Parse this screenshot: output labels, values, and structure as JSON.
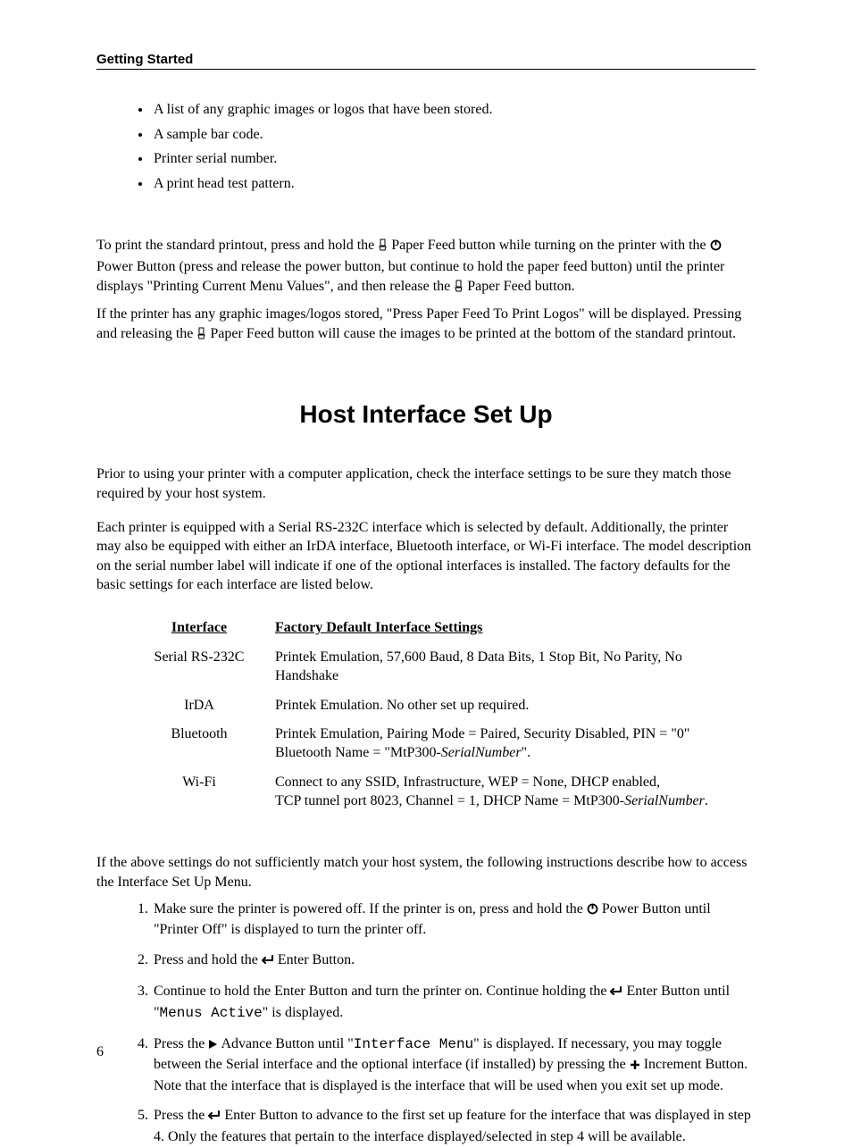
{
  "header": {
    "section": "Getting Started"
  },
  "bullets": [
    "A list of any graphic images or logos that have been stored.",
    "A sample bar code.",
    "Printer serial number.",
    "A print head test pattern."
  ],
  "para1": {
    "a": "To print the standard printout, press and hold the ",
    "b": " Paper Feed button while turning on the printer with the ",
    "c": " Power Button (press and release the power button, but continue to hold the paper feed button) until the printer displays \"Printing Current Menu Values\", and then release the ",
    "d": " Paper Feed button."
  },
  "para2": {
    "a": "If the printer has any graphic images/logos stored, \"Press Paper Feed To Print Logos\" will be displayed.  Pressing and releasing the ",
    "b": " Paper Feed button will cause the images to be printed at the bottom of the standard printout."
  },
  "heading": "Host Interface Set Up",
  "intro1": "Prior to using your printer with a computer application, check the interface settings to be sure they match those required by your host system.",
  "intro2": "Each printer is equipped with a Serial RS-232C interface which is selected by default.  Additionally, the printer may also be equipped with either an IrDA interface, Bluetooth interface, or Wi-Fi interface.  The model description on the serial number label will indicate if one of the optional interfaces is installed.  The factory defaults for the basic settings for each interface are listed below.",
  "table": {
    "headers": {
      "interface": "Interface",
      "defaults": "Factory Default Interface Settings"
    },
    "rows": [
      {
        "interface": "Serial RS-232C",
        "settings_a": "Printek Emulation, 57,600 Baud, 8 Data Bits, 1 Stop Bit, No Parity, No Handshake",
        "settings_b": "",
        "italic_a": "",
        "settings_c": "",
        "italic_b": ""
      },
      {
        "interface": "IrDA",
        "settings_a": "Printek Emulation.  No other set up required.",
        "settings_b": "",
        "italic_a": "",
        "settings_c": "",
        "italic_b": ""
      },
      {
        "interface": "Bluetooth",
        "settings_a": "Printek Emulation, Pairing Mode = Paired, Security Disabled, PIN = \"0\"",
        "settings_b": "Bluetooth Name = \"MtP300-",
        "italic_a": "SerialNumber",
        "settings_c": "\".",
        "italic_b": ""
      },
      {
        "interface": "Wi-Fi",
        "settings_a": "Connect to any SSID, Infrastructure, WEP = None, DHCP enabled,",
        "settings_b": "TCP tunnel port 8023, Channel = 1, DHCP Name = MtP300-",
        "italic_a": "SerialNumber",
        "settings_c": ".",
        "italic_b": ""
      }
    ]
  },
  "post_table": "If the above settings do not sufficiently match your host system, the following instructions describe how to access the Interface Set Up Menu.",
  "steps": {
    "s1a": "Make sure the printer is powered off.  If the printer is on, press and hold the ",
    "s1b": " Power Button until \"Printer Off\" is displayed to turn the printer off.",
    "s2a": "Press and hold the ",
    "s2b": " Enter Button.",
    "s3a": "Continue to hold the Enter Button and turn the printer on.  Continue holding the ",
    "s3b": " Enter Button until \"",
    "s3c": "Menus Active",
    "s3d": "\" is displayed.",
    "s4a": "Press the ",
    "s4b": " Advance Button until \"",
    "s4c": "Interface Menu",
    "s4d": "\" is displayed.  If necessary, you may toggle between the Serial interface and the optional interface (if installed) by pressing the ",
    "s4e": " Increment Button.  Note that the interface that is displayed is the interface that will be used when you exit set up mode.",
    "s5a": "Press the ",
    "s5b": " Enter Button to advance to the first set up feature for the interface that was displayed in step 4.  Only the features that pertain to the interface displayed/selected in step 4 will be available."
  },
  "page_number": "6"
}
